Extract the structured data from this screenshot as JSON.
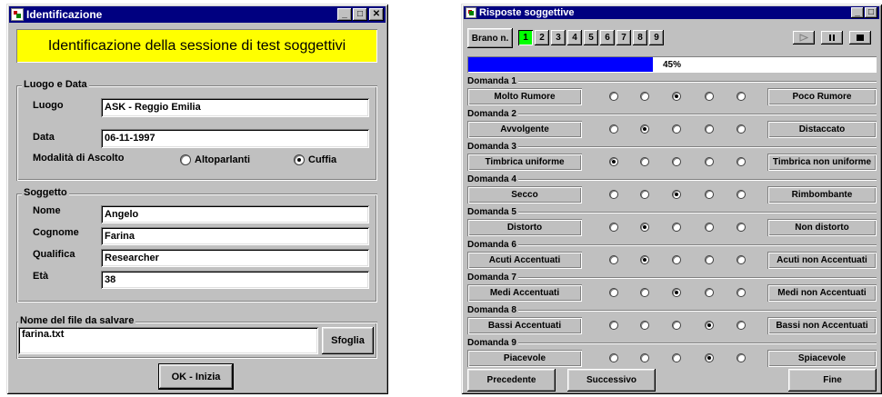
{
  "identificazione": {
    "title": "Identificazione",
    "banner": "Identificazione della sessione di test soggettivi",
    "luogo_data": {
      "group_title": "Luogo e Data",
      "luogo_label": "Luogo",
      "luogo_value": "ASK - Reggio Emilia",
      "data_label": "Data",
      "data_value": "06-11-1997",
      "modalita_label": "Modalità di Ascolto",
      "option_altoparlanti": "Altoparlanti",
      "option_cuffia": "Cuffia",
      "selected": "Cuffia"
    },
    "soggetto": {
      "group_title": "Soggetto",
      "nome_label": "Nome",
      "nome_value": "Angelo",
      "cognome_label": "Cognome",
      "cognome_value": "Farina",
      "qualifica_label": "Qualifica",
      "qualifica_value": "Researcher",
      "eta_label": "Età",
      "eta_value": "38"
    },
    "file": {
      "group_title": "Nome del file da salvare",
      "filename": "farina.txt",
      "browse_label": "Sfoglia"
    },
    "ok_label": "OK - Inizia"
  },
  "risposte": {
    "title": "Risposte soggettive",
    "brano_label": "Brano n.",
    "tracks": [
      "1",
      "2",
      "3",
      "4",
      "5",
      "6",
      "7",
      "8",
      "9"
    ],
    "selected_track": "1",
    "progress_text": "45%",
    "progress_value": 0.45,
    "questions": [
      {
        "title": "Domanda 1",
        "left": "Molto Rumore",
        "right": "Poco Rumore",
        "selected": 3
      },
      {
        "title": "Domanda 2",
        "left": "Avvolgente",
        "right": "Distaccato",
        "selected": 2
      },
      {
        "title": "Domanda 3",
        "left": "Timbrica uniforme",
        "right": "Timbrica non uniforme",
        "selected": 1
      },
      {
        "title": "Domanda 4",
        "left": "Secco",
        "right": "Rimbombante",
        "selected": 3
      },
      {
        "title": "Domanda 5",
        "left": "Distorto",
        "right": "Non distorto",
        "selected": 2
      },
      {
        "title": "Domanda 6",
        "left": "Acuti Accentuati",
        "right": "Acuti non Accentuati",
        "selected": 2
      },
      {
        "title": "Domanda 7",
        "left": "Medi Accentuati",
        "right": "Medi non Accentuati",
        "selected": 3
      },
      {
        "title": "Domanda 8",
        "left": "Bassi Accentuati",
        "right": "Bassi non Accentuati",
        "selected": 4
      },
      {
        "title": "Domanda 9",
        "left": "Piacevole",
        "right": "Spiacevole",
        "selected": 4
      }
    ],
    "prev_label": "Precedente",
    "next_label": "Successivo",
    "end_label": "Fine"
  }
}
